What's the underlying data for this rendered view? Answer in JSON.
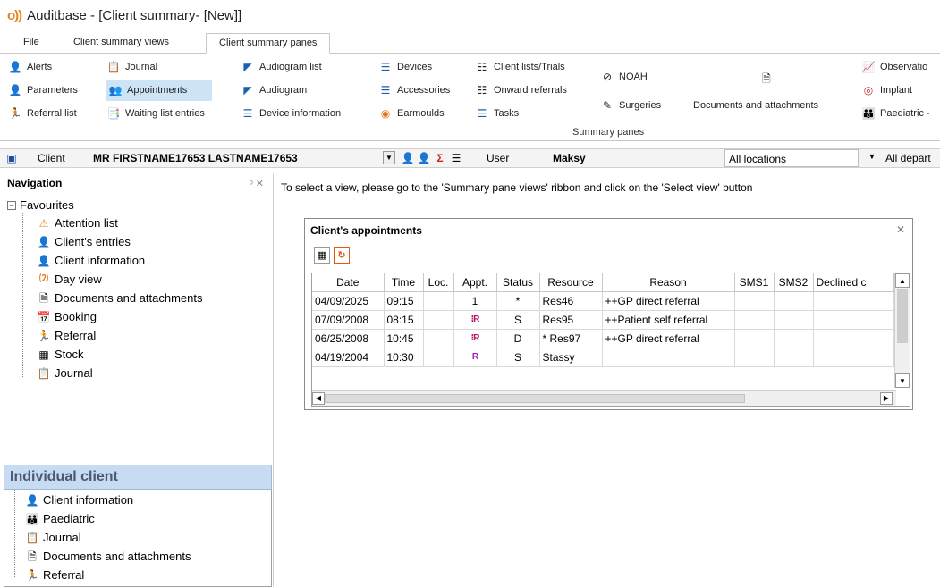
{
  "window": {
    "logo": "o))",
    "title": "Auditbase - [Client summary- [New]]"
  },
  "tabs": [
    "File",
    "Client summary views",
    "Client summary panes"
  ],
  "ribbon": {
    "alerts": "Alerts",
    "parameters": "Parameters",
    "referral_list": "Referral list",
    "journal": "Journal",
    "appointments": "Appointments",
    "waiting_list": "Waiting list entries",
    "audiogram_list": "Audiogram list",
    "audiogram": "Audiogram",
    "device_information": "Device information",
    "devices": "Devices",
    "accessories": "Accessories",
    "earmoulds": "Earmoulds",
    "client_lists": "Client lists/Trials",
    "onward_referrals": "Onward referrals",
    "tasks": "Tasks",
    "noah": "NOAH",
    "surgeries": "Surgeries",
    "documents": "Documents and attachments",
    "observations": "Observatio",
    "implant": "Implant",
    "paediatric": "Paediatric -",
    "group_label": "Summary panes"
  },
  "clientbar": {
    "client_label": "Client",
    "client_name": "MR FIRSTNAME17653 LASTNAME17653",
    "user_label": "User",
    "user_name": "Maksy",
    "locations": "All locations",
    "departments": "All depart"
  },
  "nav": {
    "header": "Navigation",
    "pin": "ᵖ ✕",
    "favourites": "Favourites",
    "items": [
      "Attention list",
      "Client's entries",
      "Client information",
      "Day view",
      "Documents and attachments",
      "Booking",
      "Referral",
      "Stock",
      "Journal"
    ],
    "individual_header": "Individual client",
    "individual_items": [
      "Client information",
      "Paediatric",
      "Journal",
      "Documents and attachments",
      "Referral"
    ]
  },
  "main": {
    "message": "To select a view, please go to the 'Summary pane views' ribbon and click on the 'Select view' button"
  },
  "appointments": {
    "title": "Client's appointments",
    "columns": [
      "Date",
      "Time",
      "Loc.",
      "Appt.",
      "Status",
      "Resource",
      "Reason",
      "SMS1",
      "SMS2",
      "Declined c"
    ],
    "rows": [
      {
        "date": "04/09/2025",
        "time": "09:15",
        "loc": "",
        "appt": "1",
        "status": "*",
        "resource": "Res46",
        "reason": "++GP direct referral"
      },
      {
        "date": "07/09/2008",
        "time": "08:15",
        "loc": "",
        "appt": "⁝R",
        "status": "S",
        "resource": "Res95",
        "reason": "++Patient self referral"
      },
      {
        "date": "06/25/2008",
        "time": "10:45",
        "loc": "",
        "appt": "⁝R",
        "status": "D",
        "resource": "* Res97",
        "reason": "++GP direct referral"
      },
      {
        "date": "04/19/2004",
        "time": "10:30",
        "loc": "",
        "appt": "R",
        "status": "S",
        "resource": "Stassy",
        "reason": ""
      }
    ]
  }
}
